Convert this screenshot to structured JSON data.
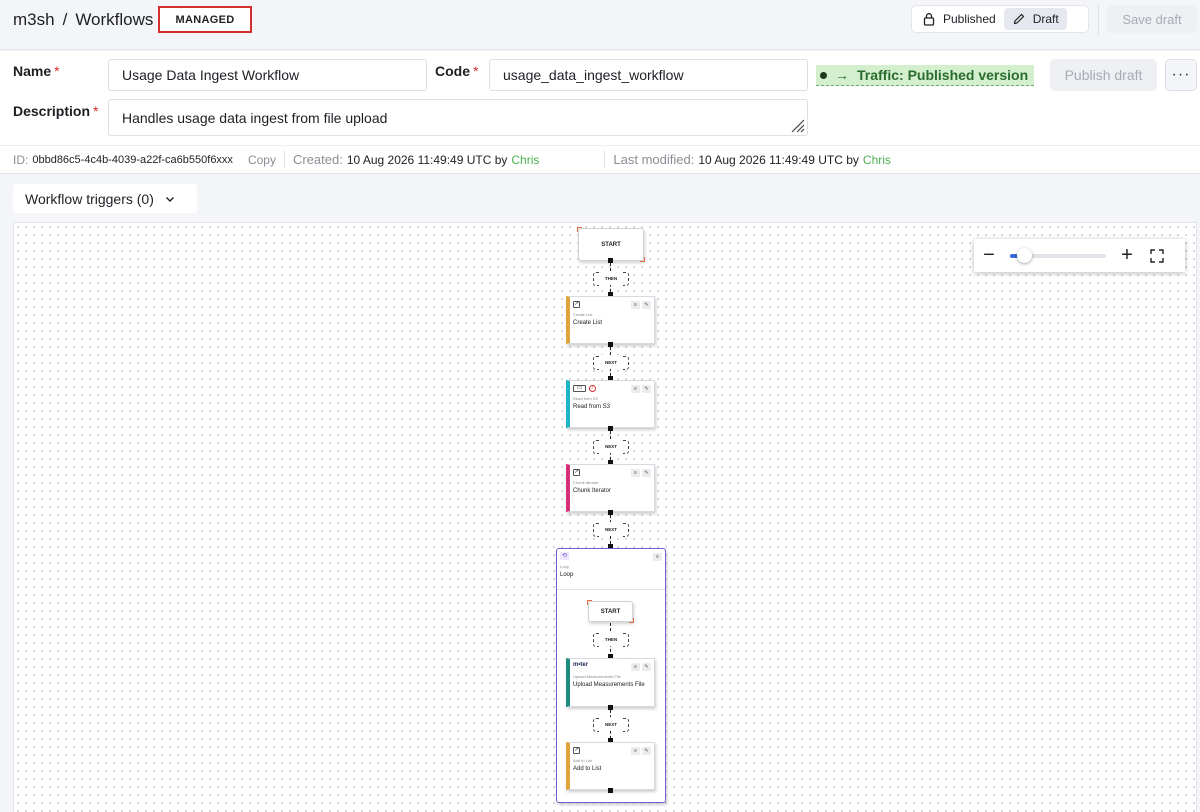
{
  "header": {
    "breadcrumb_root": "m3sh",
    "breadcrumb_separator": "/",
    "breadcrumb_current": "Workflows",
    "badge": "MANAGED",
    "published_label": "Published",
    "draft_label": "Draft",
    "save_draft_label": "Save draft"
  },
  "form": {
    "name_label": "Name",
    "name_value": "Usage Data Ingest Workflow",
    "code_label": "Code",
    "code_value": "usage_data_ingest_workflow",
    "description_label": "Description",
    "description_value": "Handles usage data ingest from file upload",
    "required_mark": "*",
    "traffic_label": "Traffic: Published version",
    "publish_draft_label": "Publish draft",
    "more_label": "···"
  },
  "meta": {
    "id_label": "ID:",
    "id_value": "0bbd86c5-4c4b-4039-a22f-ca6b550f6xxx",
    "copy_label": "Copy",
    "created_label": "Created:",
    "created_value": "10 Aug 2026 11:49:49 UTC by",
    "created_by": "Chris",
    "modified_label": "Last modified:",
    "modified_value": "10 Aug 2026 11:49:49 UTC by",
    "modified_by": "Chris"
  },
  "triggers": {
    "label": "Workflow triggers (0)"
  },
  "zoom": {
    "minus": "−",
    "plus": "+",
    "level": 0.15
  },
  "canvas": {
    "start_label": "START",
    "then_label": "THEN",
    "next_label": "NEXT",
    "steps": [
      {
        "type": "Create List",
        "name": "Create List",
        "accent": "#e0a53a"
      },
      {
        "type": "Read from S3",
        "name": "Read from S3",
        "accent": "#1fb3c4"
      },
      {
        "type": "Chunk Iterator",
        "name": "Chunk Iterator",
        "accent": "#d6307b"
      }
    ],
    "loop": {
      "type": "Loop",
      "name": "Loop",
      "inner_start": "START",
      "inner_then": "THEN",
      "inner_next": "NEXT",
      "steps": [
        {
          "logo": "m•ter",
          "type": "Upload Measurements File",
          "name": "Upload Measurements File",
          "accent": "#1f8b7f"
        },
        {
          "type": "Add to List",
          "name": "Add to List",
          "accent": "#e0a53a"
        }
      ]
    }
  },
  "colors": {
    "required": "#d32f2f",
    "traffic_bg": "#d3efce",
    "user": "#4caf50",
    "loop_border": "#7c5bd1"
  }
}
